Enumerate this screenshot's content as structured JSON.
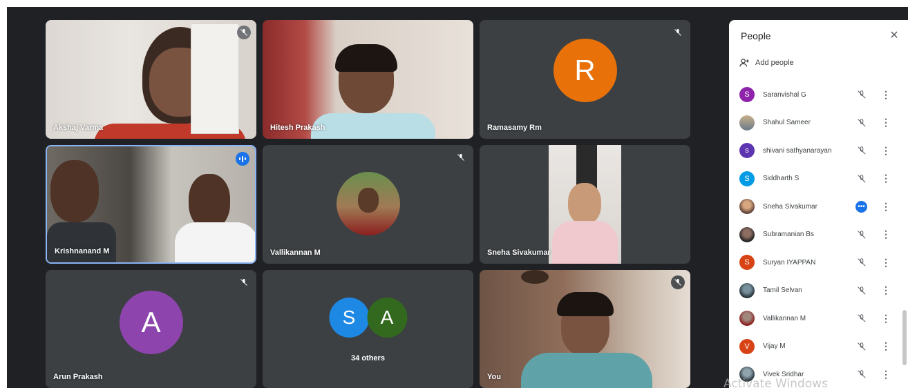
{
  "tiles": [
    {
      "name": "Akshaj Varma",
      "kind": "video",
      "muted": true
    },
    {
      "name": "Hitesh Prakash",
      "kind": "video",
      "muted": false
    },
    {
      "name": "Ramasamy Rm",
      "kind": "avatar",
      "initial": "R",
      "color": "#e8710a",
      "muted": true
    },
    {
      "name": "Krishnanand M",
      "kind": "video",
      "speaking": true
    },
    {
      "name": "Vallikannan M",
      "kind": "photo-avatar",
      "muted": true
    },
    {
      "name": "Sneha Sivakumar",
      "kind": "video",
      "muted": false
    },
    {
      "name": "Arun Prakash",
      "kind": "avatar",
      "initial": "A",
      "color": "#8e44ad",
      "muted": true
    },
    {
      "name": "34 others",
      "kind": "group",
      "initials": [
        "S",
        "A"
      ],
      "colors": [
        "#1e88e5",
        "#33691e"
      ]
    },
    {
      "name": "You",
      "kind": "video",
      "muted": true
    }
  ],
  "panel": {
    "title": "People",
    "close_icon": "close-icon",
    "add_people_label": "Add people",
    "participants": [
      {
        "name": "Saranvishal G",
        "initial": "S",
        "color": "#8e24aa",
        "muted": true
      },
      {
        "name": "Shahul Sameer",
        "initial": "",
        "color": "#8d99ae",
        "muted": true
      },
      {
        "name": "shivani sathyanarayan",
        "initial": "s",
        "color": "#5e35b1",
        "muted": true
      },
      {
        "name": "Siddharth S",
        "initial": "S",
        "color": "#039be5",
        "muted": true
      },
      {
        "name": "Sneha Sivakumar",
        "initial": "",
        "color": "#a1887f",
        "muted": false,
        "more_active": true
      },
      {
        "name": "Subramanian Bs",
        "initial": "",
        "color": "#4e342e",
        "muted": true
      },
      {
        "name": "Suryan IYAPPAN",
        "initial": "S",
        "color": "#d84315",
        "muted": true
      },
      {
        "name": "Tamil Selvan",
        "initial": "",
        "color": "#37474f",
        "muted": true
      },
      {
        "name": "Vallikannan M",
        "initial": "",
        "color": "#6d4c41",
        "muted": true
      },
      {
        "name": "Vijay M",
        "initial": "V",
        "color": "#d84315",
        "muted": true
      },
      {
        "name": "Vivek Sridhar",
        "initial": "",
        "color": "#263238",
        "muted": true
      }
    ]
  },
  "watermark": "Activate Windows"
}
